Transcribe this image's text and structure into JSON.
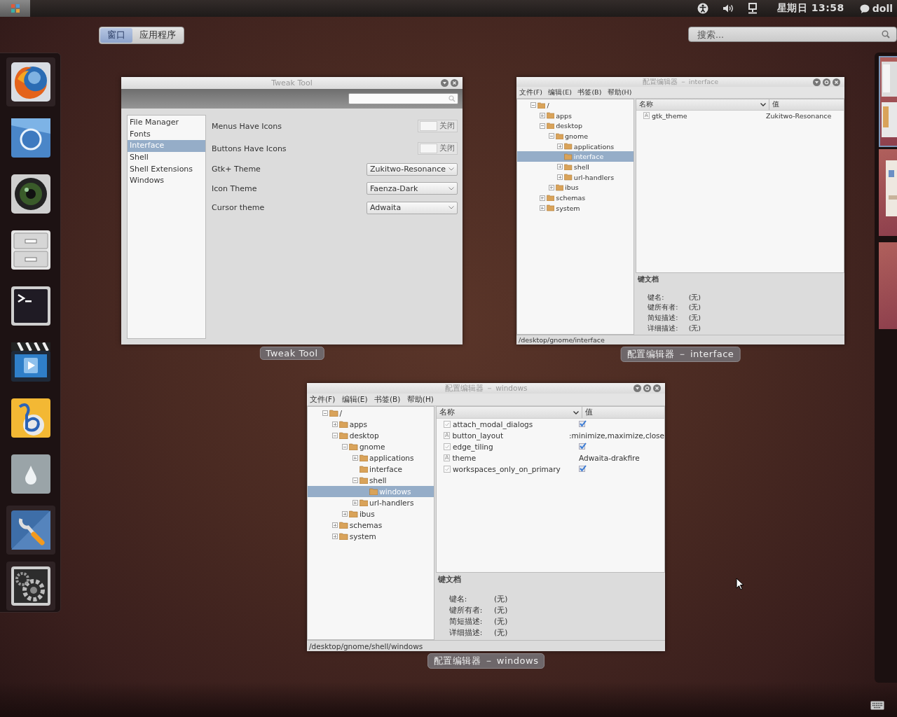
{
  "top_bar": {
    "clock": "星期日 13:58",
    "user": "doll"
  },
  "view_selector": [
    {
      "label": "窗口",
      "selected": true
    },
    {
      "label": "应用程序",
      "selected": false
    }
  ],
  "search": {
    "placeholder": "搜索..."
  },
  "dock": [
    {
      "kind": "browser",
      "running": true
    },
    {
      "kind": "ring",
      "running": false
    },
    {
      "kind": "lens",
      "running": false
    },
    {
      "kind": "drawers",
      "running": false
    },
    {
      "kind": "terminal",
      "running": false
    },
    {
      "kind": "video",
      "running": false
    },
    {
      "kind": "swirl",
      "running": false
    },
    {
      "kind": "droplet",
      "running": false
    },
    {
      "kind": "wrench",
      "running": true
    },
    {
      "kind": "gear",
      "running": true
    }
  ],
  "windows": [
    {
      "kind": "tweak_tool",
      "title": "Tweak Tool",
      "caption": "Tweak Tool",
      "title_buttons": [
        {
          "kind": "minimize"
        },
        {
          "kind": "close"
        }
      ],
      "sidebar": [
        {
          "label": "File Manager",
          "selected": false
        },
        {
          "label": "Fonts",
          "selected": false
        },
        {
          "label": "Interface",
          "selected": true
        },
        {
          "label": "Shell",
          "selected": false
        },
        {
          "label": "Shell Extensions",
          "selected": false
        },
        {
          "label": "Windows",
          "selected": false
        }
      ],
      "settings": [
        {
          "kind": "switch",
          "label": "Menus Have Icons",
          "state_text": "关闭",
          "on": false
        },
        {
          "kind": "switch",
          "label": "Buttons Have Icons",
          "state_text": "关闭",
          "on": false
        },
        {
          "kind": "combo",
          "label": "Gtk+ Theme",
          "value": "Zukitwo-Resonance"
        },
        {
          "kind": "combo",
          "label": "Icon Theme",
          "value": "Faenza-Dark"
        },
        {
          "kind": "combo",
          "label": "Cursor theme",
          "value": "Adwaita"
        }
      ]
    },
    {
      "kind": "config_editor",
      "title": "配置编辑器 － interface",
      "caption": "配置编辑器 － interface",
      "title_buttons": [
        {
          "kind": "minimize"
        },
        {
          "kind": "maximize"
        },
        {
          "kind": "close"
        }
      ],
      "menus": [
        "文件(F)",
        "编辑(E)",
        "书签(B)",
        "帮助(H)"
      ],
      "tree": [
        {
          "label": "/",
          "expanded": true,
          "selected": false,
          "children": [
            {
              "label": "apps",
              "expanded": false,
              "selected": false
            },
            {
              "label": "desktop",
              "expanded": true,
              "selected": false,
              "children": [
                {
                  "label": "gnome",
                  "expanded": true,
                  "selected": false,
                  "children": [
                    {
                      "label": "applications",
                      "expanded": false,
                      "selected": false
                    },
                    {
                      "label": "interface",
                      "selected": true
                    },
                    {
                      "label": "shell",
                      "expanded": false,
                      "selected": false
                    },
                    {
                      "label": "url-handlers",
                      "expanded": false,
                      "selected": false
                    }
                  ]
                },
                {
                  "label": "ibus",
                  "expanded": false,
                  "selected": false
                }
              ]
            },
            {
              "label": "schemas",
              "expanded": false,
              "selected": false
            },
            {
              "label": "system",
              "expanded": false,
              "selected": false
            }
          ]
        }
      ],
      "columns": [
        "名称",
        "值"
      ],
      "keys": [
        {
          "kind": "string",
          "icon": "A",
          "name": "gtk_theme",
          "value": "Zukitwo-Resonance"
        }
      ],
      "doc_heading": "键文档",
      "doc_fields": [
        {
          "label": "键名:",
          "value": "(无)"
        },
        {
          "label": "键所有者:",
          "value": "(无)"
        },
        {
          "label": "简短描述:",
          "value": "(无)"
        },
        {
          "label": "详细描述:",
          "value": "(无)"
        }
      ],
      "status": "/desktop/gnome/interface"
    },
    {
      "kind": "config_editor",
      "title": "配置编辑器 － windows",
      "caption": "配置编辑器 － windows",
      "title_buttons": [
        {
          "kind": "minimize"
        },
        {
          "kind": "maximize"
        },
        {
          "kind": "close"
        }
      ],
      "menus": [
        "文件(F)",
        "编辑(E)",
        "书签(B)",
        "帮助(H)"
      ],
      "tree": [
        {
          "label": "/",
          "expanded": true,
          "selected": false,
          "children": [
            {
              "label": "apps",
              "expanded": false,
              "selected": false
            },
            {
              "label": "desktop",
              "expanded": true,
              "selected": false,
              "children": [
                {
                  "label": "gnome",
                  "expanded": true,
                  "selected": false,
                  "children": [
                    {
                      "label": "applications",
                      "expanded": false,
                      "selected": false
                    },
                    {
                      "label": "interface",
                      "selected": false
                    },
                    {
                      "label": "shell",
                      "expanded": true,
                      "selected": false,
                      "children": [
                        {
                          "label": "windows",
                          "selected": true
                        }
                      ]
                    },
                    {
                      "label": "url-handlers",
                      "expanded": false,
                      "selected": false
                    }
                  ]
                },
                {
                  "label": "ibus",
                  "expanded": false,
                  "selected": false
                }
              ]
            },
            {
              "label": "schemas",
              "expanded": false,
              "selected": false
            },
            {
              "label": "system",
              "expanded": false,
              "selected": false
            }
          ]
        }
      ],
      "columns": [
        "名称",
        "值"
      ],
      "keys": [
        {
          "kind": "bool",
          "name": "attach_modal_dialogs",
          "checked": true
        },
        {
          "kind": "string",
          "icon": "A",
          "name": "button_layout",
          "value": ":minimize,maximize,close"
        },
        {
          "kind": "bool",
          "name": "edge_tiling",
          "checked": true
        },
        {
          "kind": "string",
          "icon": "A",
          "name": "theme",
          "value": "Adwaita-drakfire"
        },
        {
          "kind": "bool",
          "name": "workspaces_only_on_primary",
          "checked": true
        }
      ],
      "doc_heading": "键文档",
      "doc_fields": [
        {
          "label": "键名:",
          "value": "(无)"
        },
        {
          "label": "键所有者:",
          "value": "(无)"
        },
        {
          "label": "简短描述:",
          "value": "(无)"
        },
        {
          "label": "详细描述:",
          "value": "(无)"
        }
      ],
      "status": "/desktop/gnome/shell/windows"
    }
  ],
  "workspaces": [
    {
      "selected": true
    },
    {
      "selected": false
    },
    {
      "selected": false
    }
  ]
}
